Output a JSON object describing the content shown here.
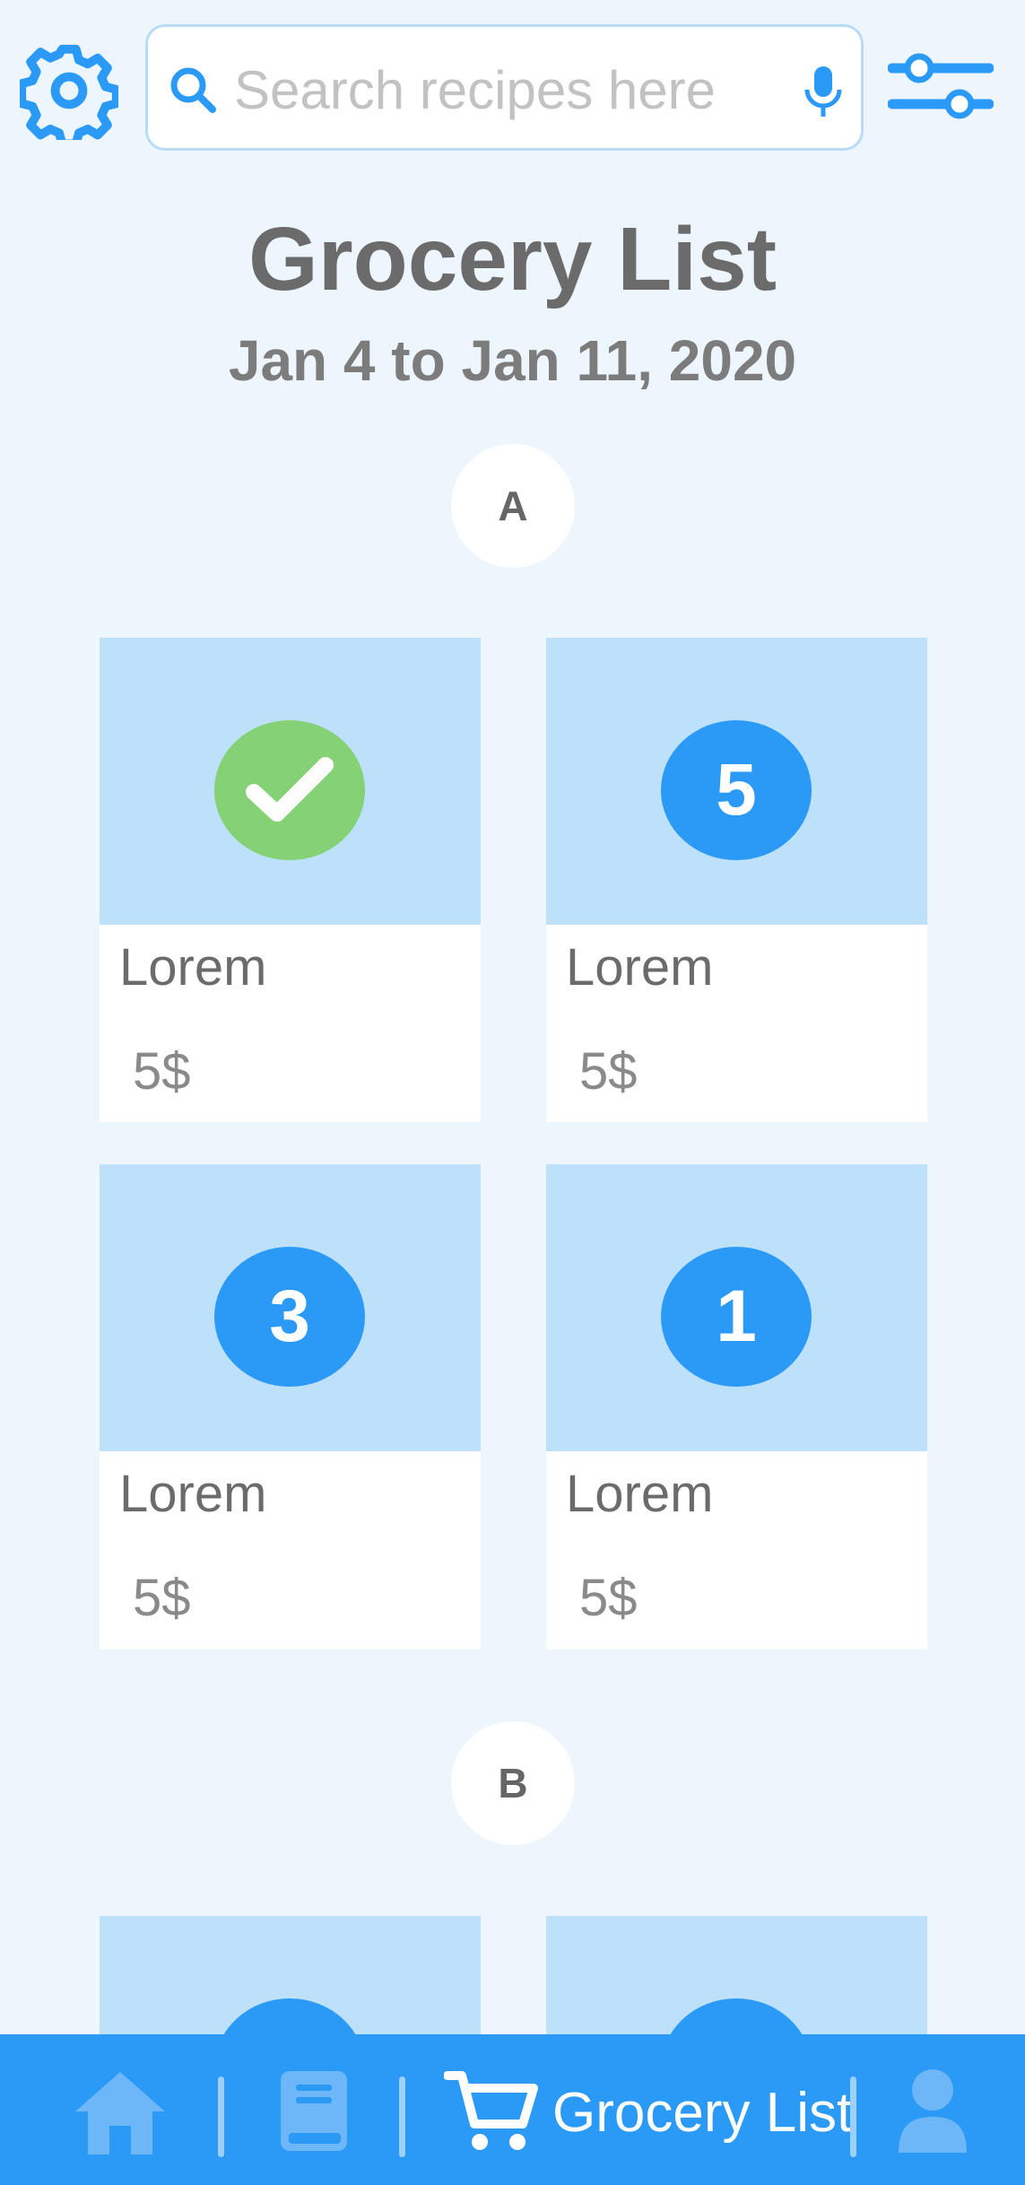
{
  "header": {
    "search_placeholder": "Search recipes here",
    "icons": [
      "gear-icon",
      "search-icon",
      "microphone-icon",
      "filter-sliders-icon"
    ]
  },
  "page": {
    "title": "Grocery List",
    "subtitle": "Jan 4 to Jan 11, 2020"
  },
  "sections": [
    {
      "letter": "A",
      "items": [
        {
          "name": "Lorem",
          "price": "5$",
          "badge": "",
          "checked": true
        },
        {
          "name": "Lorem",
          "price": "5$",
          "badge": "5",
          "checked": false
        },
        {
          "name": "Lorem",
          "price": "5$",
          "badge": "3",
          "checked": false
        },
        {
          "name": "Lorem",
          "price": "5$",
          "badge": "1",
          "checked": false
        }
      ]
    },
    {
      "letter": "B"
    }
  ],
  "nav": {
    "active_label": "Grocery List",
    "items": [
      "home-icon",
      "recipe-book-icon",
      "cart-icon",
      "profile-icon"
    ]
  },
  "colors": {
    "accent": "#2b9af6",
    "card_image": "#bde0fb",
    "check_green": "#84d176",
    "background": "#eef6fd"
  }
}
